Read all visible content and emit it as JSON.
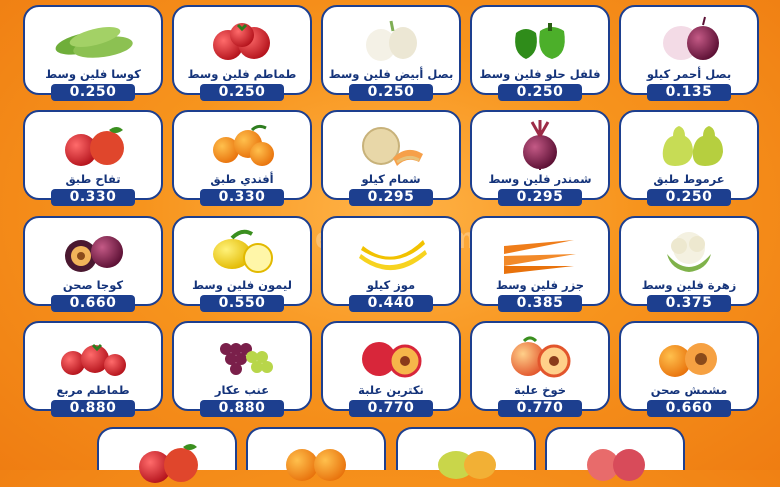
{
  "watermark": "el3rod.com",
  "rows": [
    [
      {
        "name": "كوسا فلين وسط",
        "price": "0.250",
        "icon": "zucchini-icon"
      },
      {
        "name": "طماطم فلين وسط",
        "price": "0.250",
        "icon": "tomato-icon"
      },
      {
        "name": "بصل أبيض فلين وسط",
        "price": "0.250",
        "icon": "white-onion-icon"
      },
      {
        "name": "فلفل حلو فلين وسط",
        "price": "0.250",
        "icon": "bell-pepper-icon"
      },
      {
        "name": "بصل أحمر كيلو",
        "price": "0.135",
        "icon": "red-onion-icon"
      }
    ],
    [
      {
        "name": "تفاح طبق",
        "price": "0.330",
        "icon": "apple-icon"
      },
      {
        "name": "أفندي طبق",
        "price": "0.330",
        "icon": "tangerine-icon"
      },
      {
        "name": "شمام كيلو",
        "price": "0.295",
        "icon": "cantaloupe-icon"
      },
      {
        "name": "شمندر فلين وسط",
        "price": "0.295",
        "icon": "beetroot-icon"
      },
      {
        "name": "عرموط طبق",
        "price": "0.250",
        "icon": "pear-icon"
      }
    ],
    [
      {
        "name": "كوجا صحن",
        "price": "0.660",
        "icon": "plum-icon"
      },
      {
        "name": "ليمون فلين وسط",
        "price": "0.550",
        "icon": "lemon-icon"
      },
      {
        "name": "موز كيلو",
        "price": "0.440",
        "icon": "banana-icon"
      },
      {
        "name": "جزر فلين وسط",
        "price": "0.385",
        "icon": "carrot-icon"
      },
      {
        "name": "زهرة فلين وسط",
        "price": "0.375",
        "icon": "cauliflower-icon"
      }
    ],
    [
      {
        "name": "طماطم مربع",
        "price": "0.880",
        "icon": "cherry-tomato-icon"
      },
      {
        "name": "عنب عكار",
        "price": "0.880",
        "icon": "grapes-icon"
      },
      {
        "name": "نكترين علبة",
        "price": "0.770",
        "icon": "nectarine-icon"
      },
      {
        "name": "خوخ علبة",
        "price": "0.770",
        "icon": "peach-icon"
      },
      {
        "name": "مشمش صحن",
        "price": "0.660",
        "icon": "apricot-icon"
      }
    ]
  ],
  "partial_row": [
    {
      "icon": "apple-icon"
    },
    {
      "icon": "orange-icon"
    },
    {
      "icon": "mango-icon"
    },
    {
      "icon": "red-apple-icon"
    }
  ]
}
